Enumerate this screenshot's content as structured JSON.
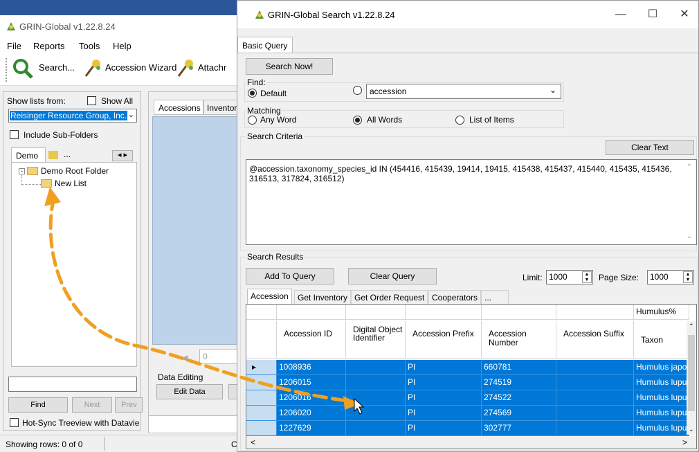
{
  "main_window": {
    "title": "GRIN-Global v1.22.8.24",
    "menu": [
      "File",
      "Reports",
      "Tools",
      "Help"
    ],
    "toolbar": {
      "search": "Search...",
      "accession_wizard": "Accession Wizard",
      "attach": "Attachr"
    },
    "show_lists_from": "Show lists from:",
    "show_all": "Show All",
    "owner": "Reisinger Resource Group, Inc.",
    "include_subfolders": "Include Sub-Folders",
    "tree_tab": "Demo",
    "tree_tab_more": "...",
    "tree": {
      "root": "Demo Root Folder",
      "child": "New List"
    },
    "data_tabs": [
      "Accessions",
      "Inventor"
    ],
    "nav_value": "0",
    "data_editing": "Data Editing",
    "edit_data": "Edit Data",
    "find": "Find",
    "next": "Next",
    "prev": "Prev",
    "hot_sync": "Hot-Sync Treeview with Datavie",
    "status": "Showing rows: 0 of 0",
    "status_extra": "C"
  },
  "search_dialog": {
    "title": "GRIN-Global Search v1.22.8.24",
    "tab": "Basic Query",
    "search_now": "Search Now!",
    "find_label": "Find:",
    "find_default": "Default",
    "find_table": "accession",
    "matching_label": "Matching",
    "matching_options": [
      "Any Word",
      "All Words",
      "List of Items"
    ],
    "criteria_label": "Search Criteria",
    "clear_text": "Clear Text",
    "criteria": "@accession.taxonomy_species_id IN (454416, 415439, 19414, 19415, 415438, 415437, 415440, 415435, 415436, 316513, 317824, 316512)",
    "results_label": "Search Results",
    "add_to_query": "Add To Query",
    "clear_query": "Clear Query",
    "limit_label": "Limit:",
    "limit": "1000",
    "page_size_label": "Page Size:",
    "page_size": "1000",
    "result_tabs": [
      "Accession",
      "Get Inventory",
      "Get Order Request",
      "Cooperators",
      "..."
    ],
    "filter_value": "Humulus%",
    "columns": [
      "Accession ID",
      "Digital Object Identifier",
      "Accession Prefix",
      "Accession Number",
      "Accession Suffix",
      "Taxon"
    ],
    "rows": [
      [
        "1008936",
        "",
        "PI",
        "660781",
        "",
        "Humulus japo"
      ],
      [
        "1206015",
        "",
        "PI",
        "274519",
        "",
        "Humulus lupu"
      ],
      [
        "1206016",
        "",
        "PI",
        "274522",
        "",
        "Humulus lupu"
      ],
      [
        "1206020",
        "",
        "PI",
        "274569",
        "",
        "Humulus lupu"
      ],
      [
        "1227629",
        "",
        "PI",
        "302777",
        "",
        "Humulus lupu"
      ]
    ]
  },
  "colors": {
    "selection": "#0078d7",
    "arrow": "#f0a020",
    "panel_blue": "#bcd3ea"
  }
}
